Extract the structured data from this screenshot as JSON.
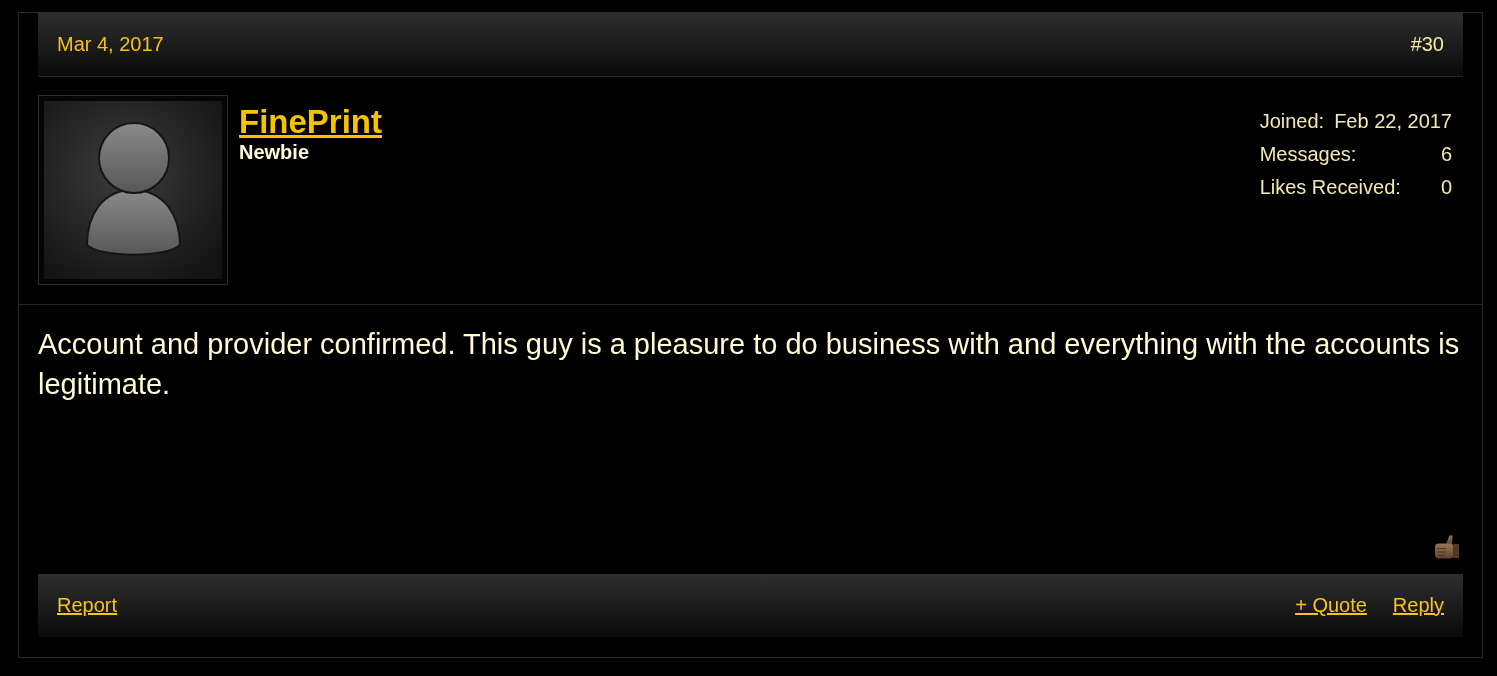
{
  "post": {
    "date": "Mar 4, 2017",
    "number": "#30"
  },
  "author": {
    "username": "FinePrint",
    "title": "Newbie"
  },
  "stats": [
    {
      "label": "Joined:",
      "value": "Feb 22, 2017"
    },
    {
      "label": "Messages:",
      "value": "6"
    },
    {
      "label": "Likes Received:",
      "value": "0"
    }
  ],
  "message": "Account and provider confirmed. This guy is a pleasure to do business with and everything with the accounts is legitimate.",
  "footer": {
    "left_links": [
      "Report"
    ],
    "right_links": [
      "+ Quote",
      "Reply"
    ]
  }
}
